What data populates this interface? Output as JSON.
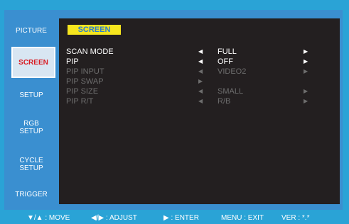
{
  "sidebar": {
    "items": [
      {
        "label": "PICTURE"
      },
      {
        "label": "SCREEN"
      },
      {
        "label": "SETUP"
      },
      {
        "label": "RGB\nSETUP"
      },
      {
        "label": "CYCLE\nSETUP"
      },
      {
        "label": "TRIGGER"
      }
    ],
    "active": "SCREEN"
  },
  "panel": {
    "title": "SCREEN",
    "rows": [
      {
        "label": "SCAN MODE",
        "left_arrow": "◀",
        "value": "FULL",
        "right_arrow": "▶",
        "enabled": true
      },
      {
        "label": "PIP",
        "left_arrow": "◀",
        "value": "OFF",
        "right_arrow": "▶",
        "enabled": true
      },
      {
        "label": "PIP INPUT",
        "left_arrow": "◀",
        "value": "VIDEO2",
        "right_arrow": "▶",
        "enabled": false
      },
      {
        "label": "PIP SWAP",
        "left_arrow": "▶",
        "value": "",
        "right_arrow": "",
        "enabled": false
      },
      {
        "label": "PIP SIZE",
        "left_arrow": "◀",
        "value": "SMALL",
        "right_arrow": "▶",
        "enabled": false
      },
      {
        "label": "PIP R/T",
        "left_arrow": "◀",
        "value": "R/B",
        "right_arrow": "▶",
        "enabled": false
      }
    ]
  },
  "footer": {
    "move": "▼/▲ : MOVE",
    "adjust": "◀/▶ : ADJUST",
    "enter": "▶ : ENTER",
    "exit": "MENU : EXIT",
    "version": "VER : *.*"
  },
  "colors": {
    "frame": "#2aa3d6",
    "panel": "#231f20",
    "title_badge": "#f6e51e",
    "active_text": "#d81b22",
    "disabled_text": "#6d6d6d"
  }
}
